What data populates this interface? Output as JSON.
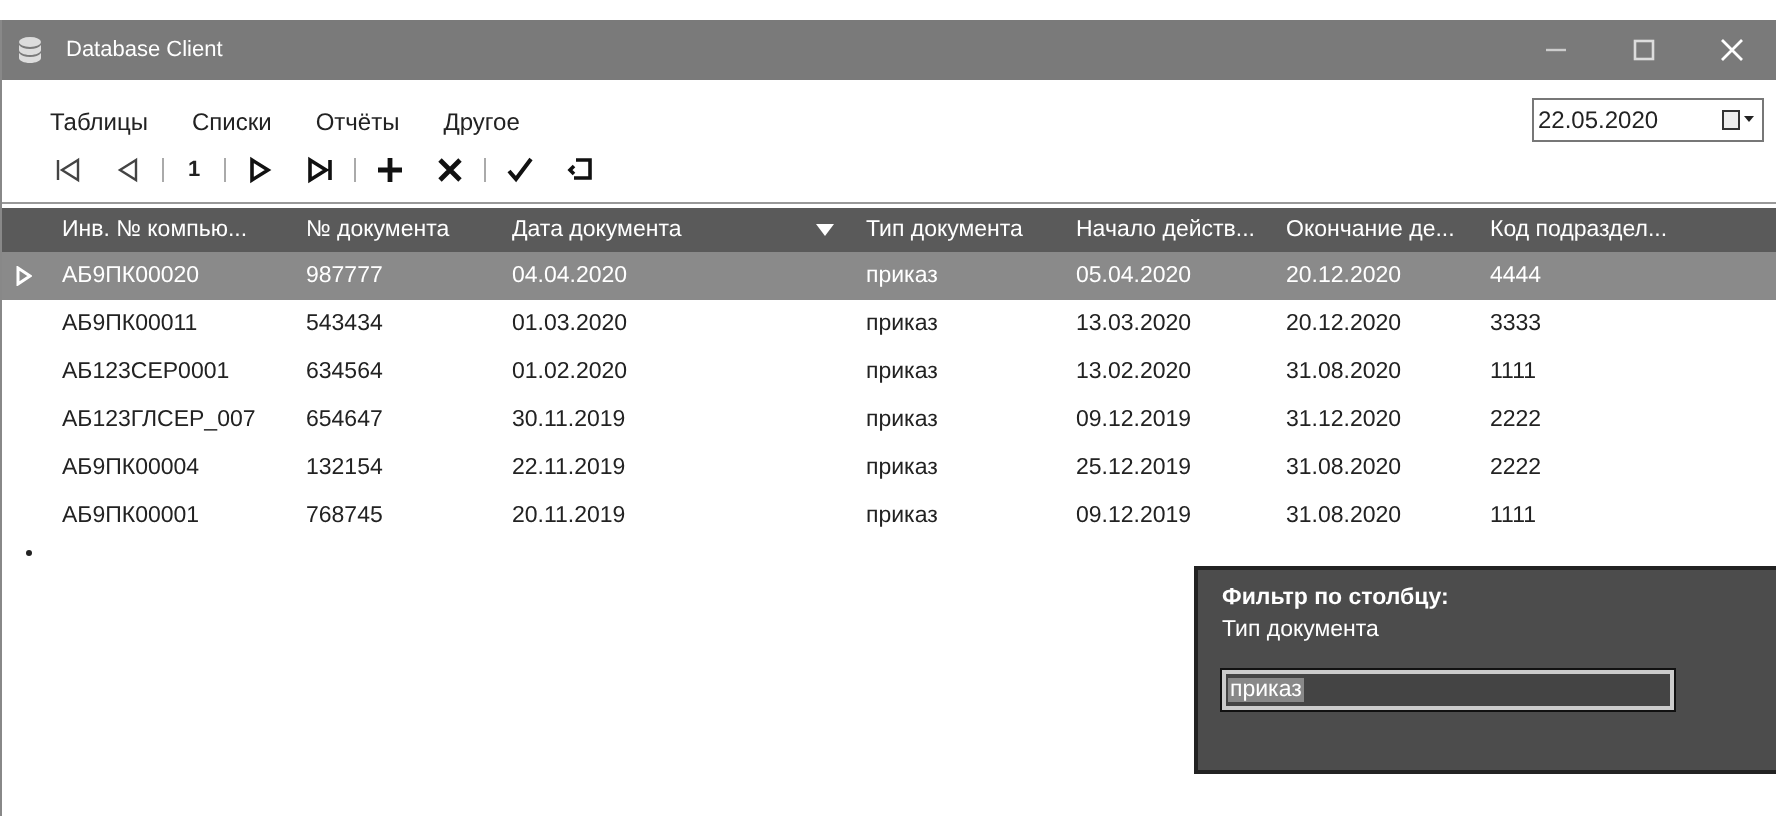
{
  "window": {
    "title": "Database Client"
  },
  "menu": [
    "Таблицы",
    "Списки",
    "Отчёты",
    "Другое"
  ],
  "date_picker": {
    "value": "22.05.2020"
  },
  "toolbar": [
    {
      "kind": "first"
    },
    {
      "kind": "prev"
    },
    {
      "kind": "sep"
    },
    {
      "kind": "page",
      "label": "1"
    },
    {
      "kind": "sep"
    },
    {
      "kind": "next"
    },
    {
      "kind": "last"
    },
    {
      "kind": "sep"
    },
    {
      "kind": "add"
    },
    {
      "kind": "delete"
    },
    {
      "kind": "sep"
    },
    {
      "kind": "save"
    },
    {
      "kind": "undo"
    }
  ],
  "table": {
    "columns": [
      {
        "label": "Инв. № компью...",
        "filtered": false
      },
      {
        "label": "№ документа",
        "filtered": false
      },
      {
        "label": "Дата документа",
        "filtered": true
      },
      {
        "label": "Тип документа",
        "filtered": false
      },
      {
        "label": "Начало действ...",
        "filtered": false
      },
      {
        "label": "Окончание де...",
        "filtered": false
      },
      {
        "label": "Код подраздел...",
        "filtered": false
      }
    ],
    "rows": [
      {
        "selected": true,
        "cells": [
          "АБ9ПК00020",
          "987777",
          "04.04.2020",
          "приказ",
          "05.04.2020",
          "20.12.2020",
          "4444"
        ]
      },
      {
        "selected": false,
        "cells": [
          "АБ9ПК00011",
          "543434",
          "01.03.2020",
          "приказ",
          "13.03.2020",
          "20.12.2020",
          "3333"
        ]
      },
      {
        "selected": false,
        "cells": [
          "АБ123СЕР0001",
          "634564",
          "01.02.2020",
          "приказ",
          "13.02.2020",
          "31.08.2020",
          "1111"
        ]
      },
      {
        "selected": false,
        "cells": [
          "АБ123ГЛСЕР_007",
          "654647",
          "30.11.2019",
          "приказ",
          "09.12.2019",
          "31.12.2020",
          "2222"
        ]
      },
      {
        "selected": false,
        "cells": [
          "АБ9ПК00004",
          "132154",
          "22.11.2019",
          "приказ",
          "25.12.2019",
          "31.08.2020",
          "2222"
        ]
      },
      {
        "selected": false,
        "cells": [
          "АБ9ПК00001",
          "768745",
          "20.11.2019",
          "приказ",
          "09.12.2019",
          "31.08.2020",
          "1111"
        ]
      }
    ]
  },
  "filter_popup": {
    "title": "Фильтр по столбцу:",
    "column": "Тип документа",
    "value": "приказ"
  }
}
